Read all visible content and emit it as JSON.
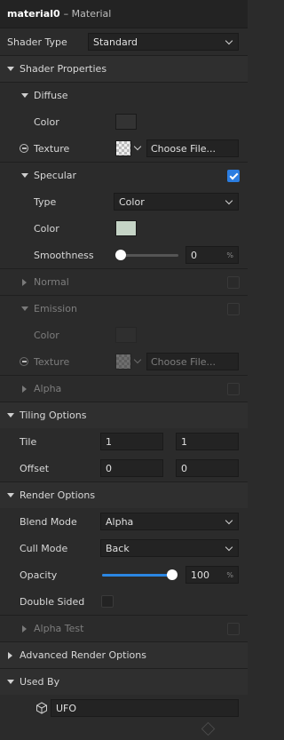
{
  "header": {
    "name": "material0",
    "type": "– Material"
  },
  "shader_type": {
    "label": "Shader Type",
    "value": "Standard"
  },
  "shader_properties": {
    "title": "Shader Properties",
    "diffuse": {
      "title": "Diffuse",
      "color_label": "Color",
      "color": "#333333",
      "texture_label": "Texture",
      "choose_file": "Choose File..."
    },
    "specular": {
      "title": "Specular",
      "checked": true,
      "type_label": "Type",
      "type_value": "Color",
      "color_label": "Color",
      "color": "#c5d4c6",
      "smoothness_label": "Smoothness",
      "smoothness_value": "0",
      "smoothness_unit": "%",
      "smoothness_fraction": 0
    },
    "normal": {
      "title": "Normal",
      "checked": false
    },
    "emission": {
      "title": "Emission",
      "checked": false,
      "color_label": "Color",
      "color": "#333333",
      "texture_label": "Texture",
      "choose_file": "Choose File..."
    },
    "alpha": {
      "title": "Alpha",
      "checked": false
    }
  },
  "tiling": {
    "title": "Tiling Options",
    "tile_label": "Tile",
    "tile_x": "1",
    "tile_y": "1",
    "offset_label": "Offset",
    "offset_x": "0",
    "offset_y": "0"
  },
  "render": {
    "title": "Render Options",
    "blend_label": "Blend Mode",
    "blend_value": "Alpha",
    "cull_label": "Cull Mode",
    "cull_value": "Back",
    "opacity_label": "Opacity",
    "opacity_value": "100",
    "opacity_unit": "%",
    "opacity_fraction": 1,
    "double_sided_label": "Double Sided",
    "double_sided": false,
    "alpha_test_label": "Alpha Test",
    "alpha_test": false
  },
  "advanced": {
    "title": "Advanced Render Options"
  },
  "used_by": {
    "title": "Used By",
    "item": "UFO"
  },
  "colors": {
    "accent": "#2b87e3",
    "background": "#2b2b2b"
  }
}
